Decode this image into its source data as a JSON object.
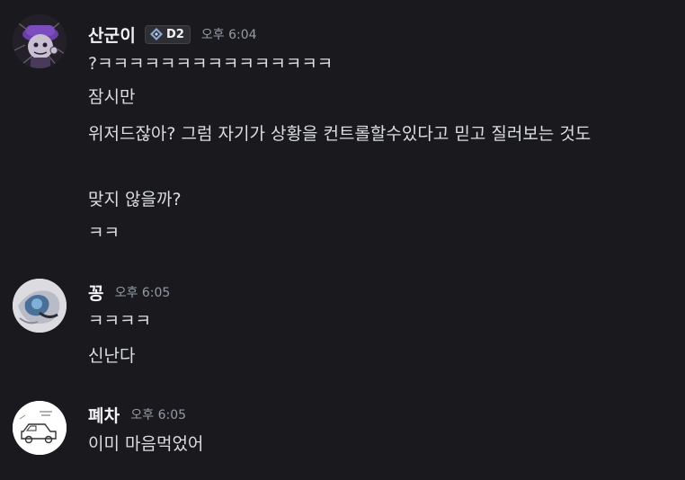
{
  "groups": [
    {
      "author": "산군이",
      "badge": "D2",
      "timestamp": "오후 6:04",
      "avatar_icon": "purple-character-avatar",
      "messages": [
        "?ㅋㅋㅋㅋㅋㅋㅋㅋㅋㅋㅋㅋㅋㅋㅋ",
        "잠시만",
        "위저드잖아? 그럼 자기가 상황을 컨트롤할수있다고 믿고 질러보는 것도",
        "맞지 않을까?",
        "ㅋㅋ"
      ]
    },
    {
      "author": "꽁",
      "timestamp": "오후 6:05",
      "avatar_icon": "blue-artwork-avatar",
      "messages": [
        "ㅋㅋㅋㅋ",
        "신난다"
      ]
    },
    {
      "author": "폐차",
      "timestamp": "오후 6:05",
      "avatar_icon": "car-doodle-avatar",
      "messages": [
        "이미 마음먹었어"
      ]
    }
  ],
  "colors": {
    "background": "#1a1a1e",
    "username": "#f2f3f5",
    "message_text": "#dbdee1",
    "timestamp": "#949ba4",
    "badge_bg": "#2e2f35"
  }
}
